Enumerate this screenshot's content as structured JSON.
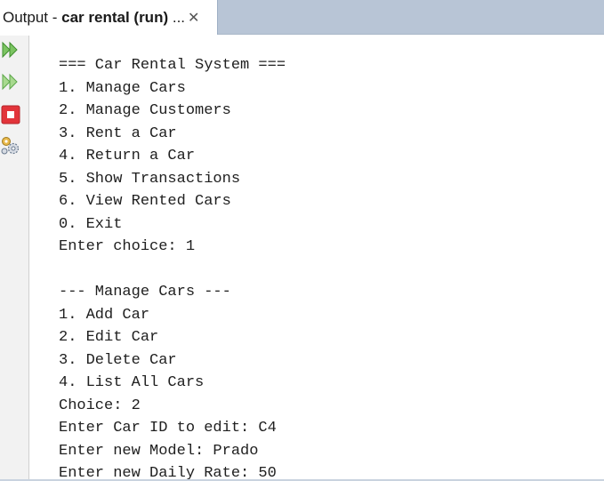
{
  "tab": {
    "prefix": "Output - ",
    "name": "car rental (run)",
    "ellipsis": " ...",
    "close_glyph": "✕"
  },
  "toolbar": {
    "items": [
      {
        "name": "rerun-icon"
      },
      {
        "name": "rerun-with-options-icon"
      },
      {
        "name": "stop-icon"
      },
      {
        "name": "settings-gears-icon"
      }
    ],
    "colors": {
      "green": "#5fb44a",
      "red": "#e2343a"
    }
  },
  "output": {
    "lines": [
      "=== Car Rental System ===",
      "1. Manage Cars",
      "2. Manage Customers",
      "3. Rent a Car",
      "4. Return a Car",
      "5. Show Transactions",
      "6. View Rented Cars",
      "0. Exit",
      "Enter choice: 1",
      "",
      "--- Manage Cars ---",
      "1. Add Car",
      "2. Edit Car",
      "3. Delete Car",
      "4. List All Cars",
      "Choice: 2",
      "Enter Car ID to edit: C4",
      "Enter new Model: Prado",
      "Enter new Daily Rate: 50"
    ]
  }
}
